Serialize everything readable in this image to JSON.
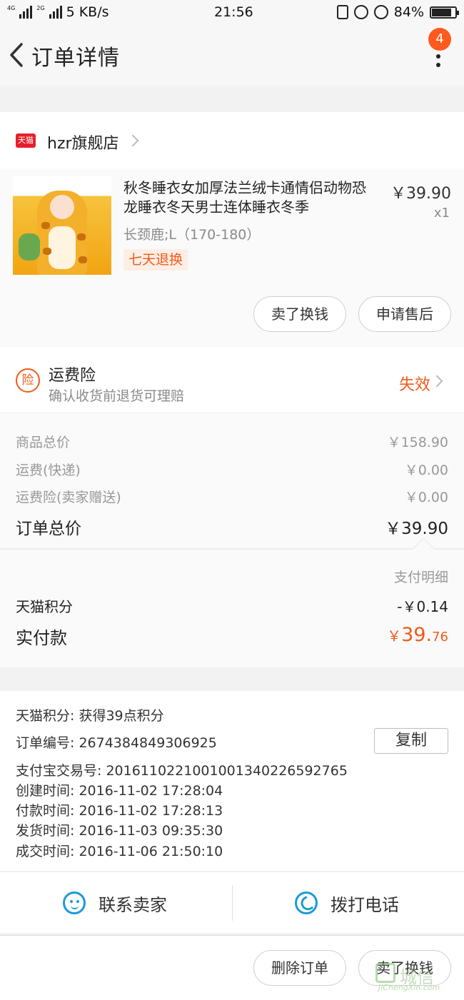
{
  "status_bar": {
    "network_labels": [
      "4G",
      "2G"
    ],
    "speed": "5 KB/s",
    "time": "21:56",
    "battery": "84%",
    "battery_level": 0.84
  },
  "nav": {
    "title": "订单详情",
    "badge": "4"
  },
  "shop": {
    "logo_text": "天猫",
    "name": "hzr旗舰店"
  },
  "product": {
    "title": "秋冬睡衣女加厚法兰绒卡通情侣动物恐龙睡衣冬天男士连体睡衣冬季",
    "spec": "长颈鹿;L（170-180）",
    "tag": "七天退换",
    "price": "￥39.90",
    "qty": "x1",
    "sell_button": "卖了换钱",
    "aftersale_button": "申请售后"
  },
  "insurance": {
    "icon_text": "险",
    "title": "运费险",
    "subtitle": "确认收货前退货可理赔",
    "status": "失效"
  },
  "summary": {
    "rows": [
      {
        "label": "商品总价",
        "value": "￥158.90"
      },
      {
        "label": "运费(快递)",
        "value": "￥0.00"
      },
      {
        "label": "运费险(卖家赠送)",
        "value": "￥0.00"
      }
    ],
    "total_label": "订单总价",
    "total_value": "￥39.90"
  },
  "payment": {
    "detail_label": "支付明细",
    "points_label": "天猫积分",
    "points_value": "-￥0.14",
    "actual_label": "实付款",
    "actual_yen": "￥",
    "actual_int": "39.",
    "actual_dec": "76"
  },
  "order_info": {
    "points": "天猫积分:   获得39点积分",
    "order_no": "订单编号:   2674384849306925",
    "copy_button": "复制",
    "alipay_no": "支付宝交易号:   2016110221001001340226592765",
    "created": "创建时间:   2016-11-02 17:28:04",
    "paid": "付款时间:   2016-11-02 17:28:13",
    "shipped": "发货时间:   2016-11-03 09:35:30",
    "completed": "成交时间:   2016-11-06 21:50:10"
  },
  "contact": {
    "seller": "联系卖家",
    "call": "拨打电话"
  },
  "bottom": {
    "delete_button": "删除订单",
    "sell_button": "卖了换钱"
  },
  "watermark": {
    "text": "城信",
    "url": "JiChengXin.com"
  },
  "colors": {
    "accent": "#f05a1a",
    "badge": "#ff5a1f",
    "tmall_red": "#e81f2b",
    "icon_blue": "#1c9ad6"
  }
}
